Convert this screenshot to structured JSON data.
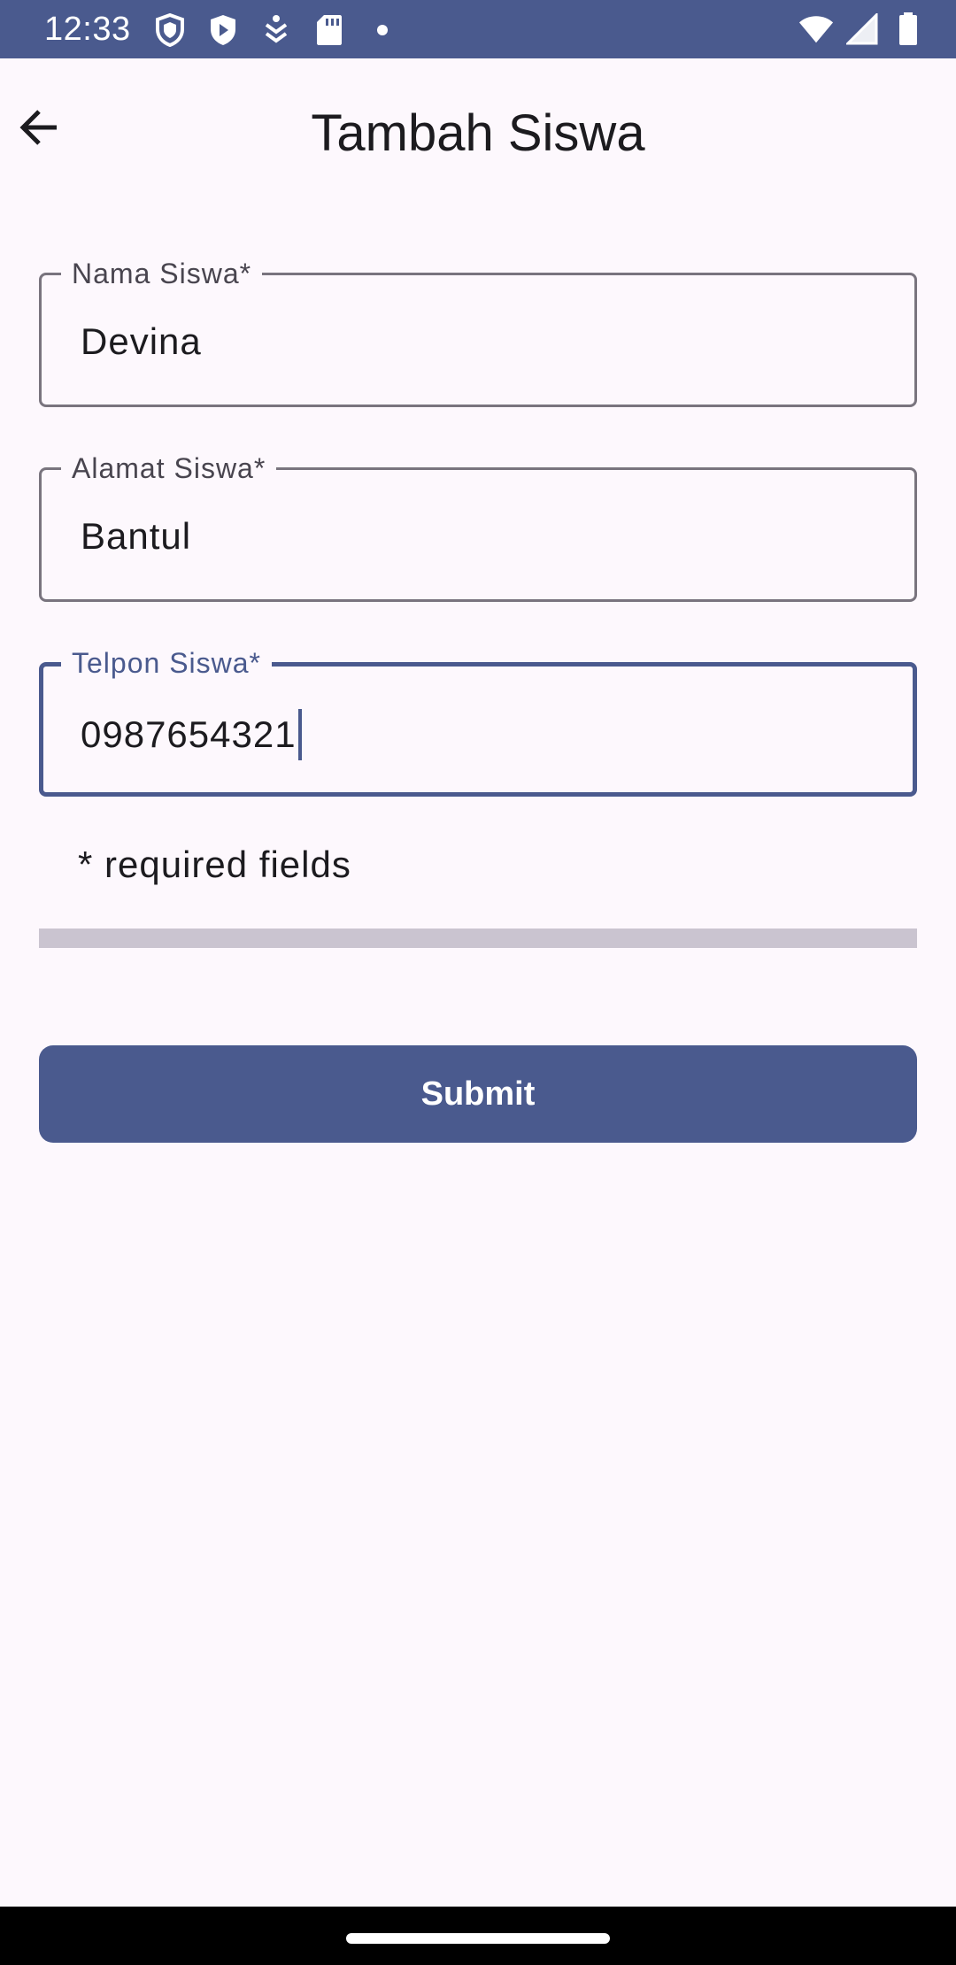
{
  "status_bar": {
    "time": "12:33",
    "left_icons": [
      "shield-icon",
      "play-protect-icon",
      "accessibility-download-icon",
      "sd-card-icon",
      "dot-icon"
    ],
    "right_icons": [
      "wifi-icon",
      "signal-icon",
      "battery-icon"
    ]
  },
  "app_bar": {
    "back_icon": "arrow-back-icon",
    "title": "Tambah Siswa"
  },
  "form": {
    "fields": [
      {
        "label": "Nama Siswa*",
        "value": "Devina",
        "focused": false
      },
      {
        "label": "Alamat Siswa*",
        "value": "Bantul",
        "focused": false
      },
      {
        "label": "Telpon Siswa*",
        "value": "0987654321",
        "focused": true
      }
    ],
    "required_note": "* required fields",
    "submit_label": "Submit"
  },
  "colors": {
    "primary": "#4a5a8e",
    "background": "#fdf8fd",
    "outline": "#79747e",
    "progress_track": "#cac4d0"
  }
}
